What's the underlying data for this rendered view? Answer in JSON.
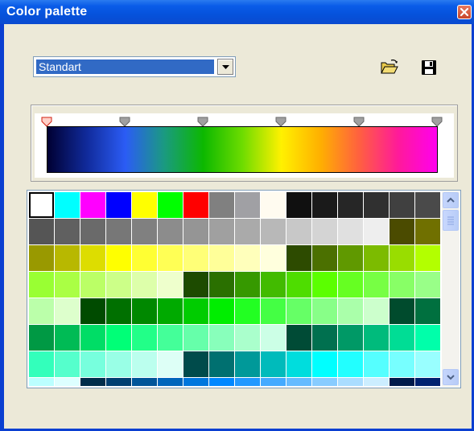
{
  "window": {
    "title": "Color palette"
  },
  "palette_select": {
    "selected": "Standart"
  },
  "icons": {
    "open": "open-folder-icon",
    "save": "floppy-disk-icon",
    "close": "close-icon"
  },
  "gradient": {
    "stops": [
      "#000033",
      "#102a9a",
      "#2b5cf5",
      "#1a9a80",
      "#0cb800",
      "#6ddc00",
      "#fff100",
      "#ffb000",
      "#ff6040",
      "#ff1a9a",
      "#ff00ee"
    ],
    "marker_count": 6,
    "selected_marker": 0
  },
  "swatches": {
    "selected_index": 0,
    "rows": [
      [
        "#ffffff",
        "#00ffff",
        "#ff00ff",
        "#0000ff",
        "#ffff00",
        "#00ff00",
        "#ff0000",
        "#808080",
        "#a0a0a4",
        "#fffbf0",
        "#101010",
        "#1a1a1a",
        "#262626",
        "#303030",
        "#404040",
        "#4a4a4a"
      ],
      [
        "#555555",
        "#606060",
        "#6a6a6a",
        "#777777",
        "#808080",
        "#8c8c8c",
        "#959595",
        "#a0a0a0",
        "#aaaaaa",
        "#b8b8b8",
        "#c8c8c8",
        "#d4d4d4",
        "#e0e0e0",
        "#eeeeee",
        "#4b4b00",
        "#707000"
      ],
      [
        "#999900",
        "#b8b800",
        "#dddd00",
        "#ffff00",
        "#ffff33",
        "#ffff55",
        "#ffff77",
        "#ffff99",
        "#ffffbb",
        "#ffffdd",
        "#2d4b00",
        "#4b7000",
        "#609900",
        "#7cbb00",
        "#99dd00",
        "#b3ff00"
      ],
      [
        "#99ff33",
        "#aaff44",
        "#bbff66",
        "#ccff88",
        "#ddffaa",
        "#eeffcc",
        "#1d4b00",
        "#2a7000",
        "#369900",
        "#42bb00",
        "#4edd00",
        "#5bff00",
        "#66ff22",
        "#77ff44",
        "#88ff66",
        "#99ff88"
      ],
      [
        "#bbffaa",
        "#ddffcc",
        "#004b00",
        "#007000",
        "#008800",
        "#00aa00",
        "#00cc00",
        "#00ee00",
        "#22ff22",
        "#44ff44",
        "#66ff66",
        "#88ff88",
        "#aaffaa",
        "#ccffcc",
        "#004b2d",
        "#00703f"
      ],
      [
        "#009944",
        "#00bb55",
        "#00dd66",
        "#00ff77",
        "#22ff88",
        "#44ff99",
        "#66ffaa",
        "#88ffbb",
        "#aaffcc",
        "#ccffe6",
        "#004b36",
        "#00704f",
        "#009966",
        "#00bb7c",
        "#00dd95",
        "#00ffaa"
      ],
      [
        "#33ffbb",
        "#55ffcc",
        "#77ffdd",
        "#99ffe6",
        "#bbffee",
        "#ddfff6",
        "#004b4b",
        "#007070",
        "#009999",
        "#00bbbb",
        "#00dddd",
        "#00ffff",
        "#22ffff",
        "#55ffff",
        "#77ffff",
        "#99ffff"
      ],
      [
        "#bbffff",
        "#ddffff",
        "#002d4b",
        "#003f70",
        "#005599",
        "#0066bb",
        "#0077dd",
        "#0088ff",
        "#2299ff",
        "#44aaff",
        "#66bbff",
        "#88ccff",
        "#aaddff",
        "#cceeff",
        "#001a4b",
        "#002270"
      ]
    ]
  }
}
